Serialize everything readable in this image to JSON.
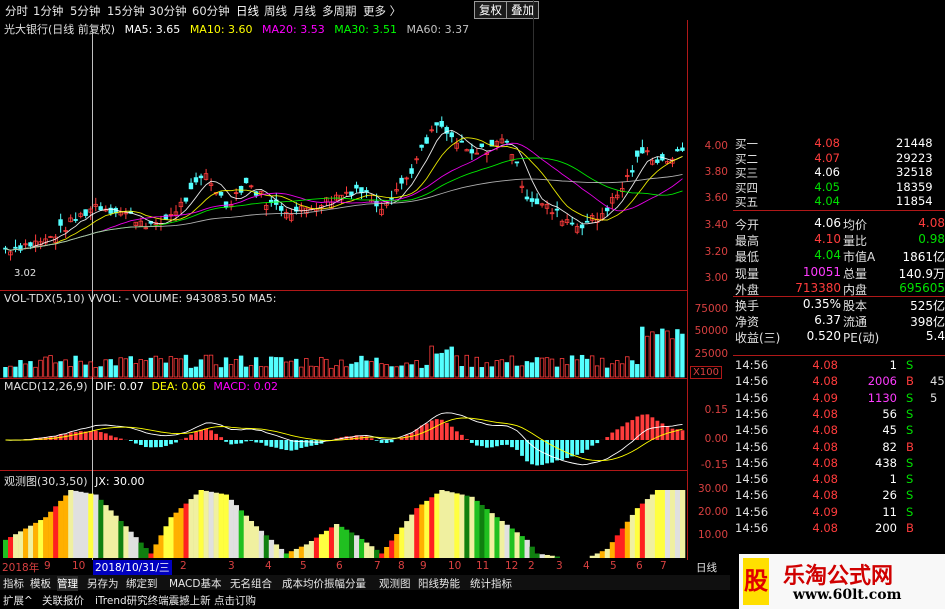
{
  "toolbar": {
    "periods": [
      "分时",
      "1分钟",
      "5分钟",
      "15分钟",
      "30分钟",
      "60分钟",
      "日线",
      "周线",
      "月线",
      "多周期",
      "更多 〉"
    ],
    "right_buttons": [
      "复权",
      "叠加"
    ]
  },
  "ma_line": {
    "stock": "光大银行(日线 前复权)",
    "ma5": "MA5: 3.65",
    "ma10": "MA10: 3.60",
    "ma20": "MA20: 3.53",
    "ma30": "MA30: 3.51",
    "ma60": "MA60: 3.37"
  },
  "price_axis": [
    "4.00",
    "3.80",
    "3.60",
    "3.40",
    "3.20",
    "3.00"
  ],
  "low_mark": "3.02",
  "vol_line": "VOL-TDX(5,10)  VVOL: -   VOLUME: 943083.50  MA5:",
  "vol_axis": [
    "75000",
    "50000",
    "25000"
  ],
  "vol_unit": "X100",
  "macd_line": {
    "name": "MACD(12,26,9)",
    "dif": "DIF: 0.07",
    "dea": "DEA: 0.06",
    "macd": "MACD: 0.02"
  },
  "macd_axis": [
    "0.15",
    "0.00",
    "-0.15"
  ],
  "gct_line": {
    "name": "观测图(30,3,50)",
    "jx": "JX: 30.00"
  },
  "gct_axis": [
    "30.00",
    "20.00",
    "10.00"
  ],
  "date_axis": {
    "year": "2018年",
    "labels": [
      "9",
      "10",
      "2018/10/31/三",
      "2",
      "3",
      "4",
      "5",
      "6",
      "7",
      "8",
      "9",
      "10",
      "11",
      "12",
      "2",
      "3",
      "4",
      "5",
      "6",
      "7",
      "8"
    ],
    "period": "日线"
  },
  "tabs": [
    "指标",
    "模板",
    "管理",
    "另存为",
    "绑定到",
    "MACD基本",
    "无名组合",
    "成本均价振幅分量",
    "观测图",
    "阳线势能",
    "统计指标"
  ],
  "bottom_tabs": [
    "扩展^",
    "关联报价",
    "iTrend研究终端震撼上新 点击订购"
  ],
  "order_book": [
    {
      "label": "买一",
      "price": "4.08",
      "vol": "21448"
    },
    {
      "label": "买二",
      "price": "4.07",
      "vol": "29223"
    },
    {
      "label": "买三",
      "price": "4.06",
      "vol": "32518"
    },
    {
      "label": "买四",
      "price": "4.05",
      "vol": "18359"
    },
    {
      "label": "买五",
      "price": "4.04",
      "vol": "11854"
    }
  ],
  "stats": [
    {
      "l1": "今开",
      "v1": "4.06",
      "l2": "均价",
      "v2": "4.08"
    },
    {
      "l1": "最高",
      "v1": "4.10",
      "l2": "量比",
      "v2": "0.98"
    },
    {
      "l1": "最低",
      "v1": "4.04",
      "l2": "市值A",
      "v2": "1861亿"
    },
    {
      "l1": "现量",
      "v1": "10051",
      "l2": "总量",
      "v2": "140.9万"
    },
    {
      "l1": "外盘",
      "v1": "713380",
      "l2": "内盘",
      "v2": "695605"
    },
    {
      "l1": "换手",
      "v1": "0.35%",
      "l2": "股本",
      "v2": "525亿"
    },
    {
      "l1": "净资",
      "v1": "6.37",
      "l2": "流通",
      "v2": "398亿"
    },
    {
      "l1": "收益(三)",
      "v1": "0.520",
      "l2": "PE(动)",
      "v2": "5.4"
    }
  ],
  "ticks": [
    {
      "t": "14:56",
      "p": "4.08",
      "v": "1",
      "s": "S"
    },
    {
      "t": "14:56",
      "p": "4.08",
      "v": "2006",
      "s": "B",
      "x": "45"
    },
    {
      "t": "14:56",
      "p": "4.09",
      "v": "1130",
      "s": "S",
      "x": "5"
    },
    {
      "t": "14:56",
      "p": "4.08",
      "v": "56",
      "s": "S"
    },
    {
      "t": "14:56",
      "p": "4.08",
      "v": "45",
      "s": "S"
    },
    {
      "t": "14:56",
      "p": "4.08",
      "v": "82",
      "s": "B"
    },
    {
      "t": "14:56",
      "p": "4.08",
      "v": "438",
      "s": "S"
    },
    {
      "t": "14:56",
      "p": "4.08",
      "v": "1",
      "s": "S"
    },
    {
      "t": "14:56",
      "p": "4.08",
      "v": "26",
      "s": "S"
    },
    {
      "t": "14:56",
      "p": "4.09",
      "v": "11",
      "s": "S"
    },
    {
      "t": "14:56",
      "p": "4.08",
      "v": "200",
      "s": "B"
    }
  ],
  "watermark": {
    "title": "乐淘公式网",
    "url": "www.60lt.com",
    "logo": "股"
  },
  "colors": {
    "up": "#ff3c3c",
    "down": "#54ffff",
    "ma5": "#ffffff",
    "ma10": "#ffff00",
    "ma20": "#ff00ff",
    "ma30": "#00ff00",
    "ma60": "#c0c0c0",
    "axis": "#b01818"
  }
}
